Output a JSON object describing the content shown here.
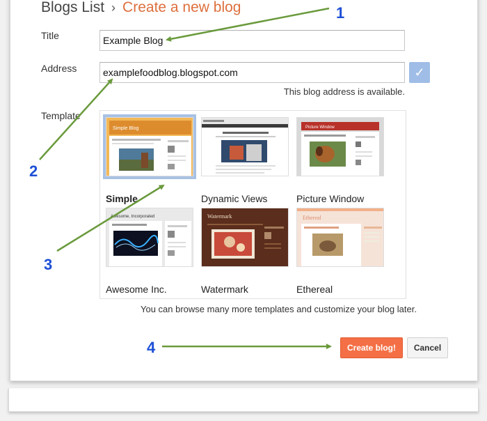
{
  "breadcrumb": {
    "parent": "Blogs List",
    "separator": "›",
    "current": "Create a new blog"
  },
  "form": {
    "title_label": "Title",
    "title_value": "Example Blog",
    "address_label": "Address",
    "address_value": "examplefoodblog.blogspot.com",
    "address_status": "This blog address is available.",
    "template_label": "Template"
  },
  "templates": [
    {
      "name": "Simple",
      "selected": true
    },
    {
      "name": "Dynamic Views",
      "selected": false
    },
    {
      "name": "Picture Window",
      "selected": false
    },
    {
      "name": "Awesome Inc.",
      "selected": false
    },
    {
      "name": "Watermark",
      "selected": false
    },
    {
      "name": "Ethereal",
      "selected": false
    }
  ],
  "thumb_texts": {
    "simple": "Simple Blog",
    "picture_window": "Picture Window",
    "awesome": "Awesome, Incorporated",
    "watermark": "Watermark",
    "ethereal": "Ethereal"
  },
  "browse_hint": "You can browse many more templates and customize your blog later.",
  "buttons": {
    "create": "Create blog!",
    "cancel": "Cancel"
  },
  "annotations": [
    "1",
    "2",
    "3",
    "4"
  ],
  "colors": {
    "accent": "#dd6f3c",
    "create_button": "#f46f45",
    "annotation_number": "#1d4fd6",
    "annotation_arrow": "#6a9a3c",
    "check_button": "#9fbde6"
  },
  "icons": {
    "check": "checkmark-icon",
    "separator": "chevron-right-icon"
  }
}
